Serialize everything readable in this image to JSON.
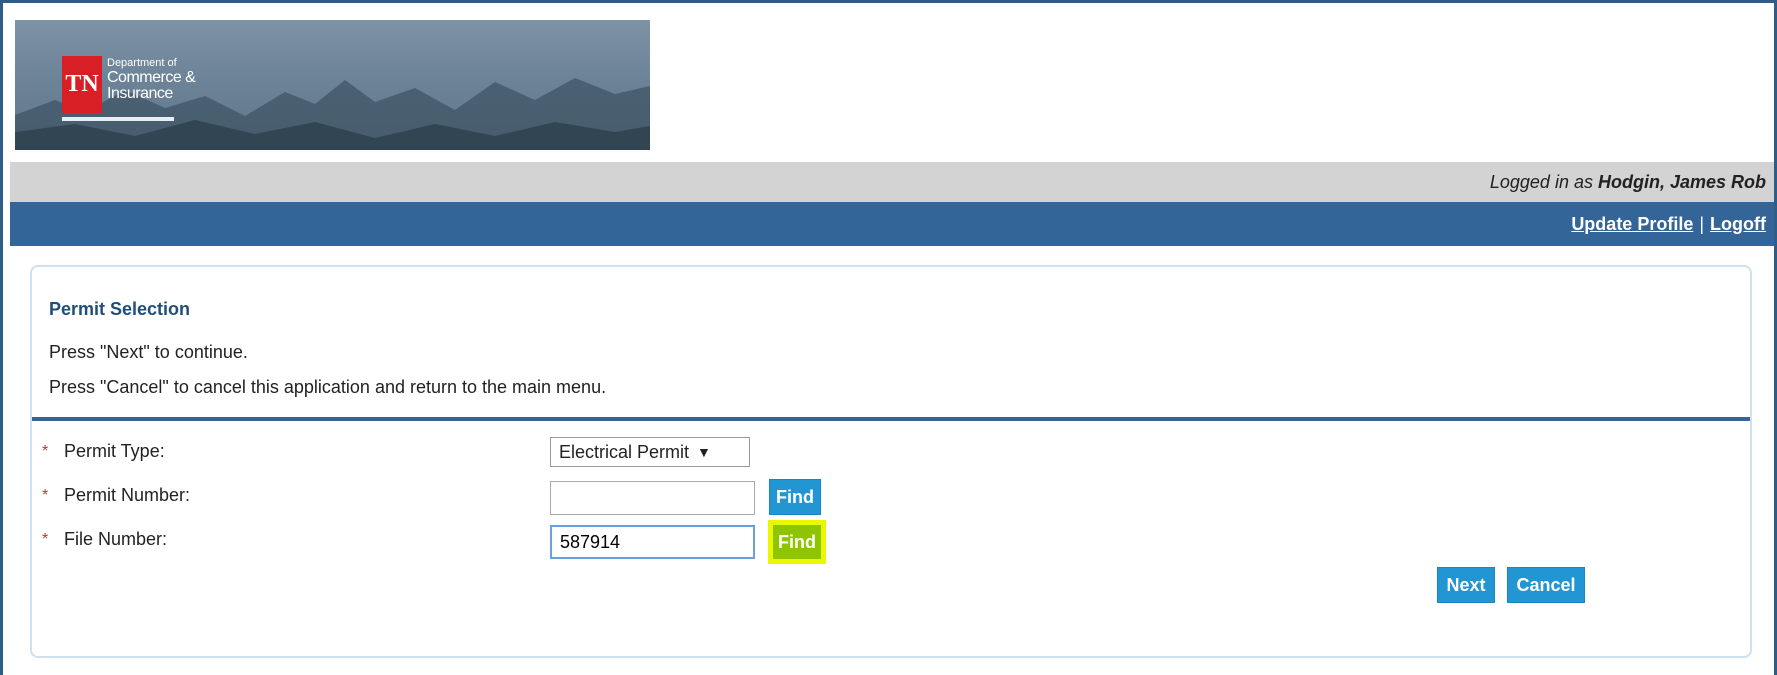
{
  "branding": {
    "logo_mark": "TN",
    "dept_line1": "Department of",
    "dept_line2": "Commerce &",
    "dept_line3": "Insurance"
  },
  "user_bar": {
    "prefix": "Logged in as",
    "user_name": "Hodgin, James Rob"
  },
  "nav": {
    "update_profile": "Update Profile",
    "separator": "|",
    "logoff": "Logoff"
  },
  "panel": {
    "title": "Permit Selection",
    "instruction1": "Press \"Next\" to continue.",
    "instruction2": "Press \"Cancel\" to cancel this application and return to the main menu."
  },
  "form": {
    "required_marker": "*",
    "permit_type": {
      "label": "Permit Type:",
      "value": "Electrical Permit",
      "arrow": "▼"
    },
    "permit_number": {
      "label": "Permit Number:",
      "value": "",
      "find_label": "Find"
    },
    "file_number": {
      "label": "File Number:",
      "value": "587914",
      "find_label": "Find"
    }
  },
  "actions": {
    "next": "Next",
    "cancel": "Cancel"
  },
  "colors": {
    "nav_blue": "#336599",
    "button_blue": "#2196d3",
    "highlight_yellow": "#e9f700",
    "required_red": "#c0392b"
  }
}
